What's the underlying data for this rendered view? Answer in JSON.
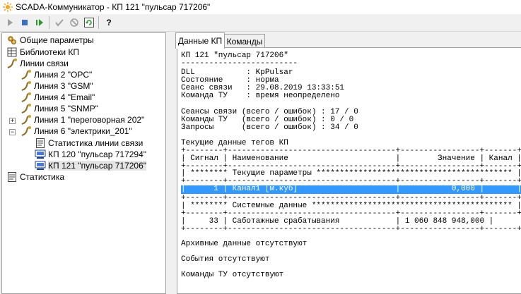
{
  "window": {
    "title": "SCADA-Коммуникатор - КП 121 \"пульсар 717206\""
  },
  "toolbar": {
    "buttons": [
      {
        "name": "start-icon"
      },
      {
        "name": "stop-icon"
      },
      {
        "name": "restart-icon"
      },
      {
        "name": "apply-icon"
      },
      {
        "name": "cancel-icon"
      },
      {
        "name": "refresh-icon"
      },
      {
        "name": "help-icon",
        "text": "?"
      }
    ]
  },
  "tree": {
    "common_params": "Общие параметры",
    "libraries": "Библиотеки КП",
    "comm_lines": "Линии связи",
    "line2": "Линия 2 \"OPC\"",
    "line3": "Линия 3 \"GSM\"",
    "line4": "Линия 4 \"Email\"",
    "line5": "Линия 5 \"SNMP\"",
    "line1": "Линия 1 \"переговорная 202\"",
    "line6": "Линия 6 \"электрики_201\"",
    "line_stats": "Статистика линии связи",
    "kp120": "КП 120 \"пульсар 717294\"",
    "kp121": "КП 121 \"пульсар 717206\"",
    "statistics": "Статистика"
  },
  "tabs": {
    "data": "Данные КП",
    "commands": "Команды"
  },
  "report": {
    "l01": "КП 121 \"пульсар 717206\"",
    "l02": "-------------------------",
    "l03": "DLL           : KpPulsar",
    "l04": "Состояние     : норма",
    "l05": "Сеанс связи   : 29.08.2019 13:33:51",
    "l06": "Команда ТУ    : время неопределено",
    "l07": "Сеансы связи (всего / ошибок) : 17 / 0",
    "l08": "Команды ТУ   (всего / ошибок) : 0 / 0",
    "l09": "Запросы      (всего / ошибок) : 34 / 0",
    "l10": "Текущие данные тегов КП",
    "l11": "+--------+------------------------------------+-----------------+-------+",
    "l12": "| Сигнал | Наименование                       |        Значение | Канал |",
    "l13": "+--------+------------------------------------+-----------------+-------+",
    "l14": "| ******** Текущие параметры ****************************************** |",
    "l15": "+--------+------------------------------------+-----------------+-------+",
    "l16": "|      1 | Канал1 [м.куб]                     |           0,000 |       |",
    "l17": "+--------+------------------------------------+-----------------+-------+",
    "l18": "| ******** Системные данные ******************************************* |",
    "l19": "+--------+------------------------------------+-----------------+-------+",
    "l20": "|     33 | Саботажные срабатывания            | 1 060 848 948,000 |       |",
    "l21": "+--------+------------------------------------+-----------------+-------+",
    "l22": "Архивные данные отсутствуют",
    "l23": "События отсутствуют",
    "l24": "Команды ТУ отсутствуют"
  }
}
